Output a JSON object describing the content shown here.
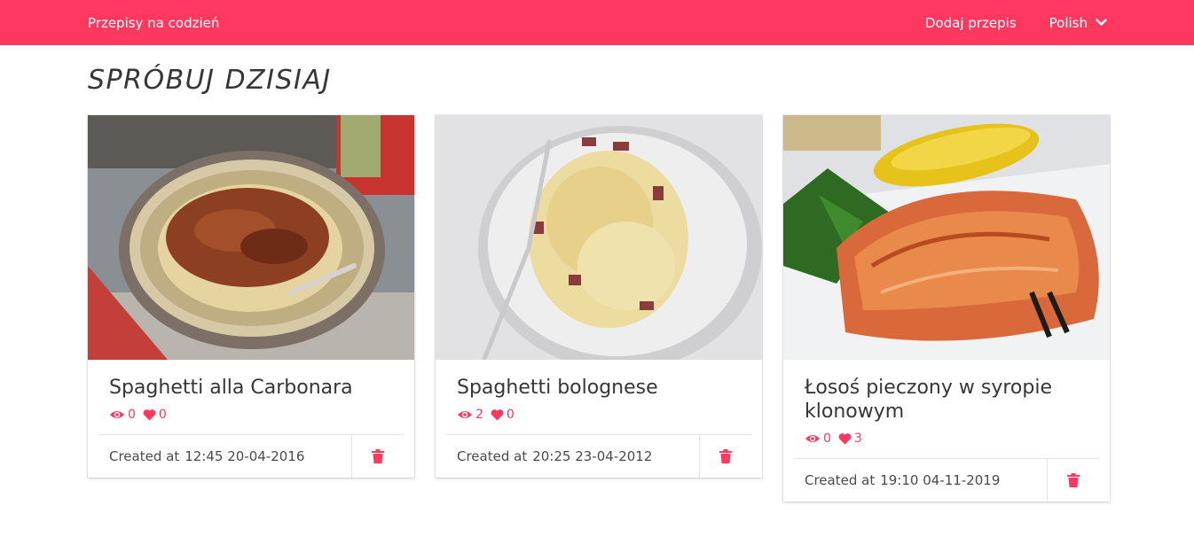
{
  "navbar": {
    "brand": "Przepisy na codzień",
    "add_recipe": "Dodaj przepis",
    "language": "Polish"
  },
  "section_title": "SPRÓBUJ DZISIAJ",
  "colors": {
    "accent": "#ff3860"
  },
  "recipes": [
    {
      "title": "Spaghetti alla Carbonara",
      "views": "0",
      "likes": "0",
      "created_label": "Created at",
      "created_value": "12:45 20-04-2016"
    },
    {
      "title": "Spaghetti bolognese",
      "views": "2",
      "likes": "0",
      "created_label": "Created at",
      "created_value": "20:25 23-04-2012"
    },
    {
      "title": "Łosoś pieczony w syropie klonowym",
      "views": "0",
      "likes": "3",
      "created_label": "Created at",
      "created_value": "19:10 04-11-2019"
    }
  ]
}
